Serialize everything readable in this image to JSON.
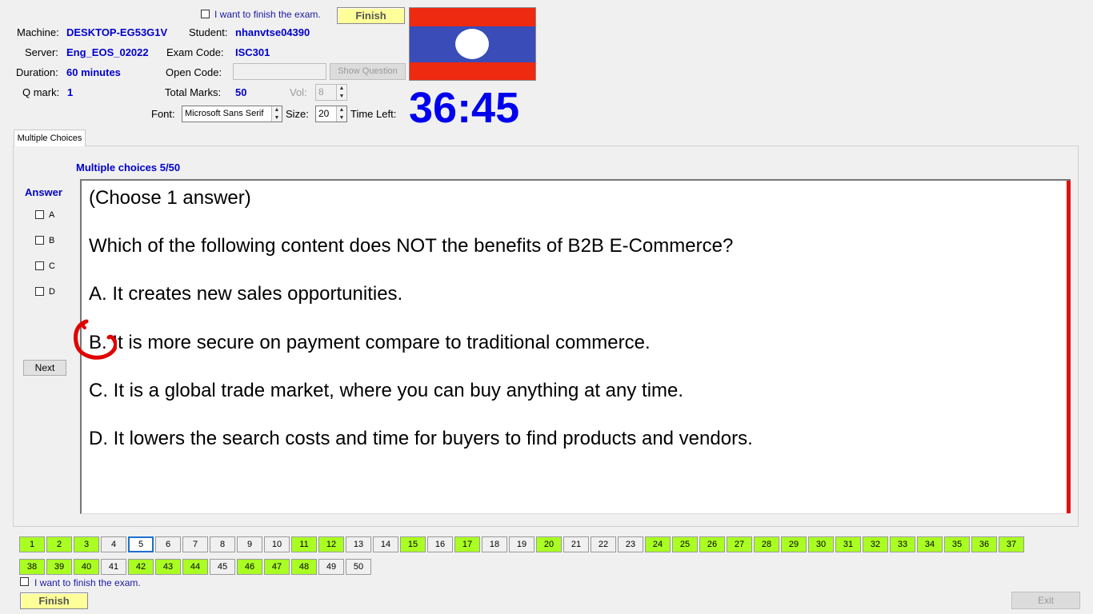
{
  "top": {
    "finish_check_label": "I want to finish the exam.",
    "finish_button": "Finish",
    "machine_label": "Machine:",
    "machine_value": "DESKTOP-EG53G1V",
    "student_label": "Student:",
    "student_value": "nhanvtse04390",
    "server_label": "Server:",
    "server_value": "Eng_EOS_02022",
    "exam_code_label": "Exam Code:",
    "exam_code_value": "ISC301",
    "duration_label": "Duration:",
    "duration_value": "60 minutes",
    "open_code_label": "Open Code:",
    "open_code_value": "",
    "show_question_button": "Show Question",
    "q_mark_label": "Q mark:",
    "q_mark_value": "1",
    "total_marks_label": "Total Marks:",
    "total_marks_value": "50",
    "vol_label": "Vol:",
    "vol_value": "8",
    "font_label": "Font:",
    "font_value": "Microsoft Sans Serif",
    "size_label": "Size:",
    "size_value": "20",
    "time_left_label": "Time Left:",
    "time_left_value": "36:45"
  },
  "tab": {
    "label": "Multiple Choices"
  },
  "question": {
    "header": "Multiple choices 5/50",
    "lines": [
      "(Choose 1 answer)",
      "Which of the following content does NOT the benefits of B2B E-Commerce?",
      "A.  It creates new sales opportunities.",
      "B.  It is more secure on payment compare to traditional commerce.",
      "C.  It is a global trade market, where you can buy anything at any time.",
      "D.  It lowers the search costs and time for buyers to find products and vendors."
    ]
  },
  "answer": {
    "title": "Answer",
    "options": [
      "A",
      "B",
      "C",
      "D"
    ],
    "next_button": "Next"
  },
  "questions_nav": [
    {
      "n": "1",
      "answered": true
    },
    {
      "n": "2",
      "answered": true
    },
    {
      "n": "3",
      "answered": true
    },
    {
      "n": "4",
      "answered": false
    },
    {
      "n": "5",
      "answered": false,
      "current": true
    },
    {
      "n": "6",
      "answered": false
    },
    {
      "n": "7",
      "answered": false
    },
    {
      "n": "8",
      "answered": false
    },
    {
      "n": "9",
      "answered": false
    },
    {
      "n": "10",
      "answered": false
    },
    {
      "n": "11",
      "answered": true
    },
    {
      "n": "12",
      "answered": true
    },
    {
      "n": "13",
      "answered": false
    },
    {
      "n": "14",
      "answered": false
    },
    {
      "n": "15",
      "answered": true
    },
    {
      "n": "16",
      "answered": false
    },
    {
      "n": "17",
      "answered": true
    },
    {
      "n": "18",
      "answered": false
    },
    {
      "n": "19",
      "answered": false
    },
    {
      "n": "20",
      "answered": true
    },
    {
      "n": "21",
      "answered": false
    },
    {
      "n": "22",
      "answered": false
    },
    {
      "n": "23",
      "answered": false
    },
    {
      "n": "24",
      "answered": true
    },
    {
      "n": "25",
      "answered": true
    },
    {
      "n": "26",
      "answered": true
    },
    {
      "n": "27",
      "answered": true
    },
    {
      "n": "28",
      "answered": true
    },
    {
      "n": "29",
      "answered": true
    },
    {
      "n": "30",
      "answered": true
    },
    {
      "n": "31",
      "answered": true
    },
    {
      "n": "32",
      "answered": true
    },
    {
      "n": "33",
      "answered": true
    },
    {
      "n": "34",
      "answered": true
    },
    {
      "n": "35",
      "answered": true
    },
    {
      "n": "36",
      "answered": true
    },
    {
      "n": "37",
      "answered": true
    },
    {
      "n": "38",
      "answered": true
    },
    {
      "n": "39",
      "answered": true
    },
    {
      "n": "40",
      "answered": true
    },
    {
      "n": "41",
      "answered": false
    },
    {
      "n": "42",
      "answered": true
    },
    {
      "n": "43",
      "answered": true
    },
    {
      "n": "44",
      "answered": true
    },
    {
      "n": "45",
      "answered": false
    },
    {
      "n": "46",
      "answered": true
    },
    {
      "n": "47",
      "answered": true
    },
    {
      "n": "48",
      "answered": true
    },
    {
      "n": "49",
      "answered": false
    },
    {
      "n": "50",
      "answered": false
    }
  ],
  "bottom": {
    "finish_check_label": "I want to finish the exam.",
    "finish_button": "Finish",
    "exit_button": "Exit"
  },
  "colors": {
    "answered": "#aaff22",
    "value_blue": "#0000cc",
    "timer_blue": "#0000ee",
    "scroll_red": "#e01010",
    "annotation_red": "#e00000"
  },
  "annotation": {
    "circled_option": "B"
  }
}
